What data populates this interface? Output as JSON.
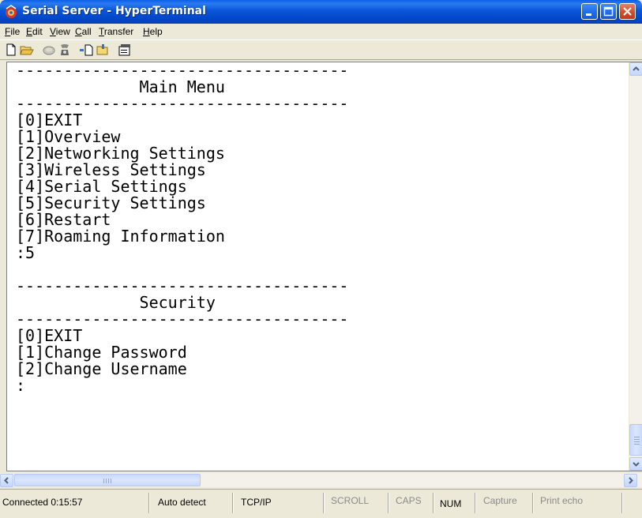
{
  "window": {
    "title": "Serial Server - HyperTerminal",
    "accent": "#0054e3",
    "close_color": "#d0492a"
  },
  "menubar": {
    "items": [
      {
        "label": "File",
        "key": "F",
        "rest": "ile"
      },
      {
        "label": "Edit",
        "key": "E",
        "rest": "dit"
      },
      {
        "label": "View",
        "key": "V",
        "rest": "iew"
      },
      {
        "label": "Call",
        "key": "C",
        "rest": "all"
      },
      {
        "label": "Transfer",
        "key": "T",
        "rest": "ransfer"
      },
      {
        "label": "Help",
        "key": "H",
        "rest": "elp"
      }
    ]
  },
  "toolbar": {
    "icons": [
      "new-icon",
      "open-icon",
      "disconnect-icon",
      "dial-icon",
      "send-icon",
      "receive-icon",
      "properties-icon"
    ]
  },
  "terminal": {
    "lines": [
      "-----------------------------------",
      "             Main Menu",
      "-----------------------------------",
      "[0]EXIT",
      "[1]Overview",
      "[2]Networking Settings",
      "[3]Wireless Settings",
      "[4]Serial Settings",
      "[5]Security Settings",
      "[6]Restart",
      "[7]Roaming Information",
      ":5",
      "",
      "-----------------------------------",
      "             Security",
      "-----------------------------------",
      "[0]EXIT",
      "[1]Change Password",
      "[2]Change Username",
      ":"
    ]
  },
  "statusbar": {
    "connected": "Connected 0:15:57",
    "emulation": "Auto detect",
    "protocol": "TCP/IP",
    "scroll": "SCROLL",
    "caps": "CAPS",
    "num": "NUM",
    "capture": "Capture",
    "print_echo": "Print echo"
  }
}
